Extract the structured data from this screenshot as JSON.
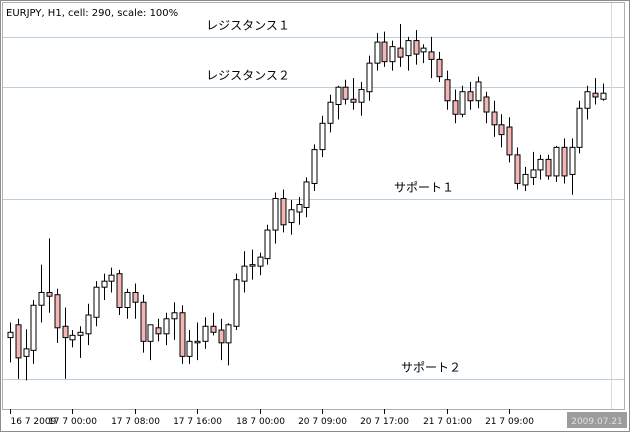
{
  "window": {
    "symbol_info": "EURJPY, H1, cell: 290, scale: 100%"
  },
  "colors": {
    "background": "#ffffff",
    "frame": "#9a9a9a",
    "level_line": "#b9cfe0",
    "bull_body": "#ffffff",
    "bear_body": "#f2b6b6",
    "wick": "#000000",
    "cursor_label_bg": "#9c9c9c",
    "cursor_label_text": "#d8d8d8"
  },
  "chart_data": {
    "type": "candlestick",
    "instrument": "EURJPY",
    "timeframe": "H1",
    "levels": [
      {
        "name": "レジスタンス１",
        "value": 136.45
      },
      {
        "name": "レジスタンス２",
        "value": 135.78
      },
      {
        "name": "サポート１",
        "value": 134.29
      },
      {
        "name": "サポート２",
        "value": 131.9
      }
    ],
    "x_ticks": [
      {
        "label": "16 7 2009",
        "index": 0
      },
      {
        "label": "17 7 00:00",
        "index": 8
      },
      {
        "label": "17 7 08:00",
        "index": 16
      },
      {
        "label": "17 7 16:00",
        "index": 24
      },
      {
        "label": "18 7 00:00",
        "index": 32
      },
      {
        "label": "20 7 09:00",
        "index": 40
      },
      {
        "label": "20 7 17:00",
        "index": 48
      },
      {
        "label": "21 7 01:00",
        "index": 56
      },
      {
        "label": "21 7 09:00",
        "index": 64
      }
    ],
    "cursor_label": "2009.07.21",
    "ylim": [
      131.5,
      136.9
    ],
    "candles": [
      [
        132.45,
        132.65,
        132.12,
        132.52
      ],
      [
        132.62,
        132.7,
        131.9,
        132.18
      ],
      [
        132.2,
        132.56,
        131.88,
        132.3
      ],
      [
        132.28,
        132.95,
        132.1,
        132.88
      ],
      [
        132.88,
        133.42,
        132.65,
        133.05
      ],
      [
        133.05,
        133.77,
        132.78,
        133.0
      ],
      [
        133.02,
        133.1,
        132.38,
        132.58
      ],
      [
        132.6,
        132.85,
        131.9,
        132.45
      ],
      [
        132.42,
        132.55,
        132.32,
        132.48
      ],
      [
        132.48,
        132.6,
        132.18,
        132.52
      ],
      [
        132.5,
        132.9,
        132.35,
        132.75
      ],
      [
        132.72,
        133.2,
        132.6,
        133.12
      ],
      [
        133.12,
        133.3,
        132.95,
        133.2
      ],
      [
        133.2,
        133.38,
        133.05,
        133.28
      ],
      [
        133.3,
        133.35,
        132.75,
        132.85
      ],
      [
        132.85,
        133.1,
        132.7,
        133.05
      ],
      [
        133.05,
        133.17,
        132.7,
        132.92
      ],
      [
        132.92,
        133.02,
        132.25,
        132.4
      ],
      [
        132.4,
        132.62,
        132.15,
        132.62
      ],
      [
        132.58,
        132.7,
        132.4,
        132.5
      ],
      [
        132.5,
        132.78,
        132.35,
        132.7
      ],
      [
        132.7,
        132.92,
        132.42,
        132.78
      ],
      [
        132.78,
        132.88,
        132.1,
        132.2
      ],
      [
        132.2,
        132.55,
        132.1,
        132.4
      ],
      [
        132.38,
        132.65,
        132.15,
        132.4
      ],
      [
        132.4,
        132.72,
        132.3,
        132.6
      ],
      [
        132.6,
        132.78,
        132.48,
        132.52
      ],
      [
        132.55,
        132.7,
        132.15,
        132.38
      ],
      [
        132.38,
        132.64,
        132.08,
        132.62
      ],
      [
        132.6,
        133.3,
        132.55,
        133.22
      ],
      [
        133.2,
        133.6,
        133.05,
        133.4
      ],
      [
        133.4,
        133.62,
        133.22,
        133.42
      ],
      [
        133.4,
        133.58,
        133.28,
        133.52
      ],
      [
        133.5,
        133.95,
        133.42,
        133.88
      ],
      [
        133.88,
        134.38,
        133.7,
        134.3
      ],
      [
        134.3,
        134.42,
        133.85,
        133.95
      ],
      [
        133.98,
        134.28,
        133.82,
        134.15
      ],
      [
        134.12,
        134.32,
        133.95,
        134.22
      ],
      [
        134.18,
        134.58,
        134.05,
        134.52
      ],
      [
        134.5,
        135.02,
        134.4,
        134.95
      ],
      [
        134.95,
        135.4,
        134.85,
        135.3
      ],
      [
        135.3,
        135.68,
        135.18,
        135.58
      ],
      [
        135.55,
        135.8,
        135.35,
        135.78
      ],
      [
        135.78,
        135.88,
        135.55,
        135.62
      ],
      [
        135.62,
        135.9,
        135.48,
        135.58
      ],
      [
        135.58,
        135.85,
        135.4,
        135.75
      ],
      [
        135.72,
        136.2,
        135.6,
        136.1
      ],
      [
        136.1,
        136.5,
        136.0,
        136.38
      ],
      [
        136.38,
        136.52,
        136.05,
        136.12
      ],
      [
        136.12,
        136.4,
        136.0,
        136.32
      ],
      [
        136.3,
        136.62,
        136.05,
        136.18
      ],
      [
        136.2,
        136.45,
        136.0,
        136.4
      ],
      [
        136.4,
        136.54,
        136.08,
        136.22
      ],
      [
        136.25,
        136.35,
        136.1,
        136.3
      ],
      [
        136.25,
        136.45,
        135.9,
        136.15
      ],
      [
        136.15,
        136.25,
        135.85,
        135.92
      ],
      [
        135.88,
        136.0,
        135.48,
        135.6
      ],
      [
        135.6,
        135.75,
        135.3,
        135.42
      ],
      [
        135.42,
        135.8,
        135.38,
        135.72
      ],
      [
        135.72,
        135.85,
        135.48,
        135.6
      ],
      [
        135.6,
        135.92,
        135.5,
        135.85
      ],
      [
        135.65,
        135.72,
        135.3,
        135.45
      ],
      [
        135.45,
        135.6,
        135.12,
        135.28
      ],
      [
        135.28,
        135.42,
        134.98,
        135.15
      ],
      [
        135.25,
        135.38,
        134.78,
        134.88
      ],
      [
        134.88,
        134.98,
        134.42,
        134.5
      ],
      [
        134.48,
        134.72,
        134.4,
        134.62
      ],
      [
        134.58,
        134.92,
        134.48,
        134.68
      ],
      [
        134.68,
        134.88,
        134.55,
        134.82
      ],
      [
        134.82,
        134.88,
        134.55,
        134.6
      ],
      [
        134.6,
        135.0,
        134.52,
        134.98
      ],
      [
        134.98,
        135.1,
        134.5,
        134.6
      ],
      [
        134.62,
        135.1,
        134.35,
        134.98
      ],
      [
        134.98,
        135.6,
        134.9,
        135.5
      ],
      [
        135.5,
        135.8,
        135.35,
        135.72
      ],
      [
        135.7,
        135.9,
        135.55,
        135.65
      ],
      [
        135.62,
        135.83,
        135.6,
        135.7
      ]
    ]
  }
}
